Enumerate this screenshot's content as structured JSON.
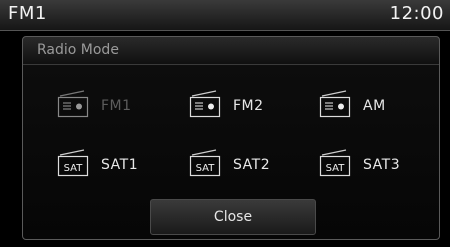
{
  "status_bar": {
    "station": "FM1",
    "clock": "12:00"
  },
  "dialog": {
    "title": "Radio Mode",
    "modes": [
      {
        "label": "FM1",
        "icon": "radio-icon",
        "enabled": false
      },
      {
        "label": "FM2",
        "icon": "radio-icon",
        "enabled": true
      },
      {
        "label": "AM",
        "icon": "radio-icon",
        "enabled": true
      },
      {
        "label": "SAT1",
        "icon": "sat-radio-icon",
        "icon_text": "SAT",
        "enabled": true
      },
      {
        "label": "SAT2",
        "icon": "sat-radio-icon",
        "icon_text": "SAT",
        "enabled": true
      },
      {
        "label": "SAT3",
        "icon": "sat-radio-icon",
        "icon_text": "SAT",
        "enabled": true
      }
    ],
    "close_label": "Close"
  },
  "colors": {
    "background": "#000000",
    "text": "#e8e8e8",
    "disabled_text": "#5c5c5c"
  }
}
